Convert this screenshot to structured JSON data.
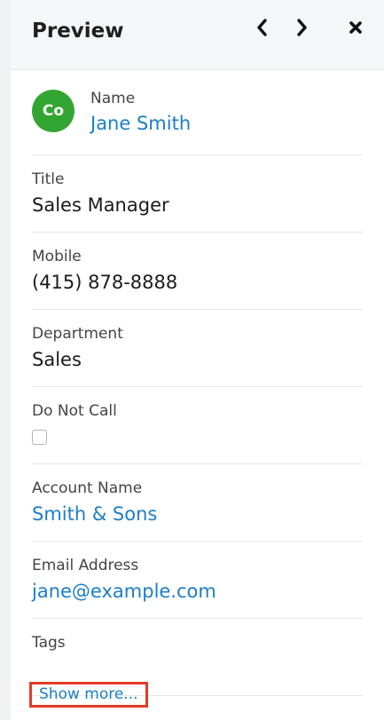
{
  "header": {
    "title": "Preview",
    "prev_icon": "‹",
    "next_icon": "›",
    "close_icon": "✖"
  },
  "record": {
    "avatar_initials": "Co",
    "avatar_color": "#33a532",
    "name_label": "Name",
    "name_value": "Jane Smith",
    "fields": [
      {
        "label": "Title",
        "value": "Sales Manager"
      },
      {
        "label": "Mobile",
        "value": "(415) 878-8888"
      },
      {
        "label": "Department",
        "value": "Sales"
      },
      {
        "label": "Do Not Call",
        "value": "",
        "checked": false
      },
      {
        "label": "Account Name",
        "value": "Smith & Sons"
      },
      {
        "label": "Email Address",
        "value": "jane@example.com"
      },
      {
        "label": "Tags",
        "value": ""
      }
    ]
  },
  "footer": {
    "show_more": "Show more..."
  },
  "colors": {
    "link": "#1c7ec6",
    "highlight_border": "#e53a2a"
  }
}
